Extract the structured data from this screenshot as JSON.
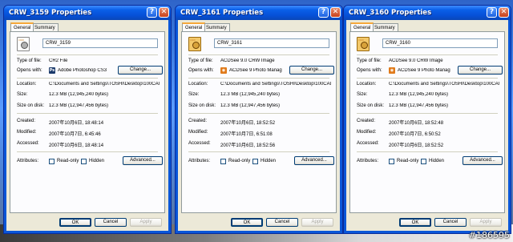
{
  "watermark": "#186595",
  "windows": [
    {
      "title": "CRW_3159 Properties",
      "tabs": [
        "General",
        "Summary"
      ],
      "file_name": "CRW_3159",
      "icon_type": "generic",
      "type_of_file_label": "Type of file:",
      "type_of_file": "CR2 File",
      "opens_with_label": "Opens with:",
      "opens_with": "Adobe Photoshop CS3",
      "opens_with_icon": "photoshop-icon",
      "change_label": "Change...",
      "location_label": "Location:",
      "location": "C:\\Documents and Settings\\TOSHI\\Desktop\\100CAI",
      "size_label": "Size:",
      "size": "12.3 MB (12,945,240 bytes)",
      "size_on_disk_label": "Size on disk:",
      "size_on_disk": "12.3 MB (12,947,456 bytes)",
      "created_label": "Created:",
      "created": "2007年10月6日, 18:48:14",
      "modified_label": "Modified:",
      "modified": "2007年10月7日, 6:45:46",
      "accessed_label": "Accessed:",
      "accessed": "2007年10月6日, 18:48:14",
      "attributes_label": "Attributes:",
      "readonly_label": "Read-only",
      "hidden_label": "Hidden",
      "advanced_label": "Advanced...",
      "ok_label": "OK",
      "cancel_label": "Cancel",
      "apply_label": "Apply"
    },
    {
      "title": "CRW_3161 Properties",
      "tabs": [
        "General",
        "Summary"
      ],
      "file_name": "CRW_3161",
      "icon_type": "acdsee",
      "type_of_file_label": "Type of file:",
      "type_of_file": "ACDSee 9.0 CRW Image",
      "opens_with_label": "Opens with:",
      "opens_with": "ACDSee 9 Photo Manag",
      "opens_with_icon": "acdsee-icon",
      "change_label": "Change...",
      "location_label": "Location:",
      "location": "C:\\Documents and Settings\\TOSHI\\Desktop\\100CAI",
      "size_label": "Size:",
      "size": "12.3 MB (12,945,240 bytes)",
      "size_on_disk_label": "Size on disk:",
      "size_on_disk": "12.3 MB (12,947,456 bytes)",
      "created_label": "Created:",
      "created": "2007年10月6日, 18:52:52",
      "modified_label": "Modified:",
      "modified": "2007年10月7日, 6:51:08",
      "accessed_label": "Accessed:",
      "accessed": "2007年10月6日, 18:52:56",
      "attributes_label": "Attributes:",
      "readonly_label": "Read-only",
      "hidden_label": "Hidden",
      "advanced_label": "Advanced...",
      "ok_label": "OK",
      "cancel_label": "Cancel",
      "apply_label": "Apply"
    },
    {
      "title": "CRW_3160 Properties",
      "tabs": [
        "General",
        "Summary"
      ],
      "file_name": "CRW_3160",
      "icon_type": "acdsee",
      "type_of_file_label": "Type of file:",
      "type_of_file": "ACDSee 9.0 CRW Image",
      "opens_with_label": "Opens with:",
      "opens_with": "ACDSee 9 Photo Manag",
      "opens_with_icon": "acdsee-icon",
      "change_label": "Change...",
      "location_label": "Location:",
      "location": "C:\\Documents and Settings\\TOSHI\\Desktop\\100CAI",
      "size_label": "Size:",
      "size": "12.3 MB (12,945,240 bytes)",
      "size_on_disk_label": "Size on disk:",
      "size_on_disk": "12.3 MB (12,947,456 bytes)",
      "created_label": "Created:",
      "created": "2007年10月6日, 18:52:48",
      "modified_label": "Modified:",
      "modified": "2007年10月7日, 6:50:52",
      "accessed_label": "Accessed:",
      "accessed": "2007年10月6日, 18:52:52",
      "attributes_label": "Attributes:",
      "readonly_label": "Read-only",
      "hidden_label": "Hidden",
      "advanced_label": "Advanced...",
      "ok_label": "OK",
      "cancel_label": "Cancel",
      "apply_label": "Apply"
    }
  ]
}
